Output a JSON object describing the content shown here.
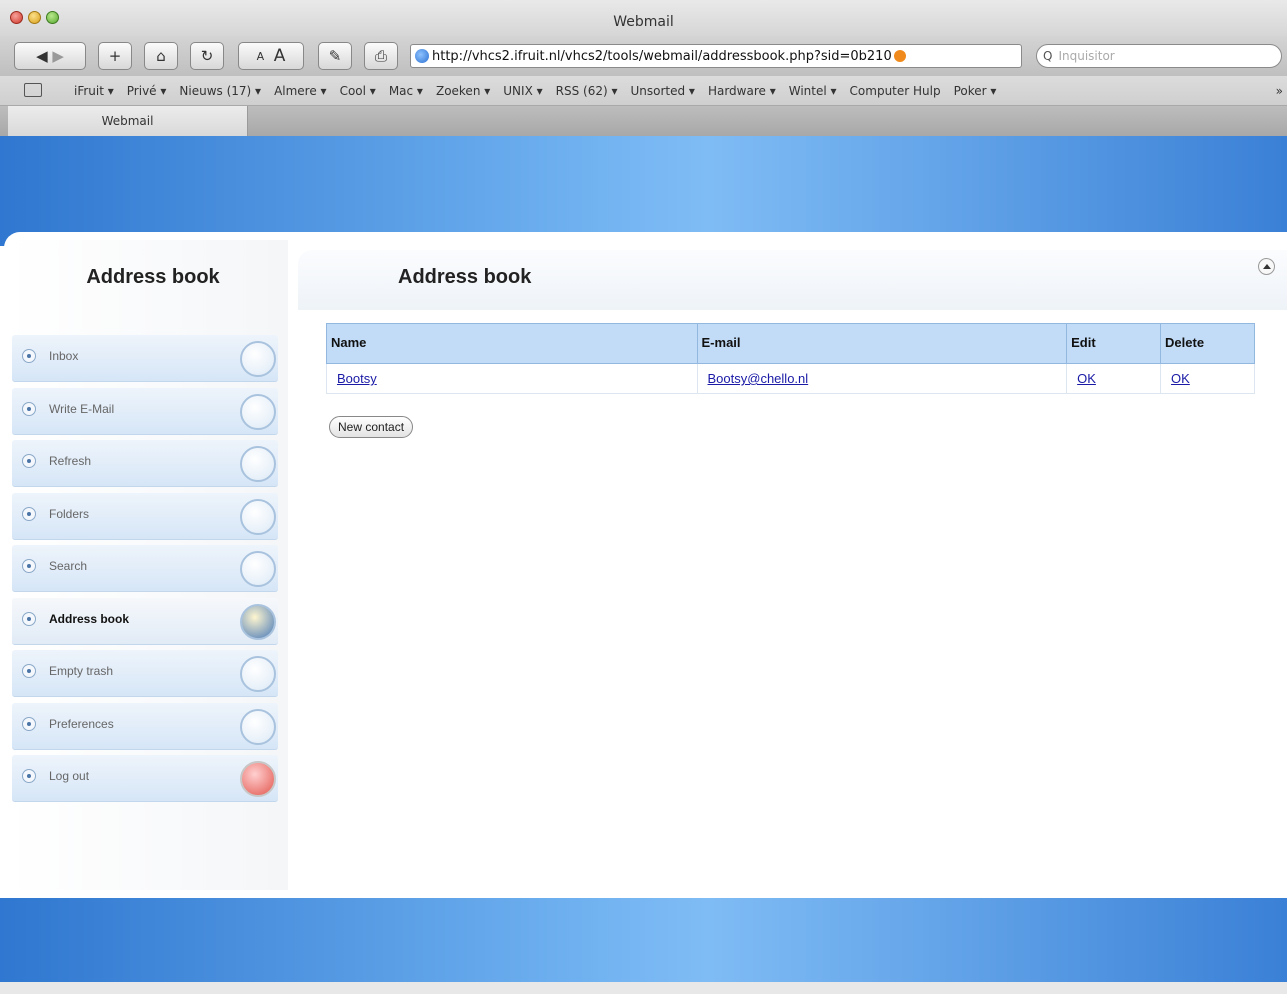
{
  "window": {
    "title": "Webmail"
  },
  "toolbar": {
    "back_icon": "back-forward-icon",
    "add_label": "+",
    "text_small": "A",
    "text_large": "A",
    "url": "http://vhcs2.ifruit.nl/vhcs2/tools/webmail/addressbook.php?sid=0b210",
    "search_placeholder": "Inquisitor",
    "search_glyph": "Q"
  },
  "bookmarks": {
    "items": [
      "iFruit ▾",
      "Privé ▾",
      "Nieuws (17) ▾",
      "Almere ▾",
      "Cool ▾",
      "Mac ▾",
      "Zoeken ▾",
      "UNIX ▾",
      "RSS (62) ▾",
      "Unsorted ▾",
      "Hardware ▾",
      "Wintel ▾",
      "Computer Hulp",
      "Poker ▾"
    ],
    "more": "»"
  },
  "tabs": [
    {
      "label": "Webmail"
    }
  ],
  "sidebar": {
    "title": "Address book",
    "items": [
      {
        "label": "Inbox",
        "icon": "inbox-icon"
      },
      {
        "label": "Write E-Mail",
        "icon": "write-icon"
      },
      {
        "label": "Refresh",
        "icon": "refresh-icon"
      },
      {
        "label": "Folders",
        "icon": "folders-icon"
      },
      {
        "label": "Search",
        "icon": "search-icon"
      },
      {
        "label": "Address book",
        "icon": "addressbook-icon",
        "active": true
      },
      {
        "label": "Empty trash",
        "icon": "trash-icon"
      },
      {
        "label": "Preferences",
        "icon": "preferences-icon"
      },
      {
        "label": "Log out",
        "icon": "logout-icon"
      }
    ]
  },
  "main": {
    "title": "Address book",
    "table": {
      "headers": [
        "Name",
        "E-mail",
        "Edit",
        "Delete"
      ],
      "rows": [
        {
          "name": "Bootsy",
          "email": "Bootsy@chello.nl",
          "edit": "OK",
          "delete": "OK"
        }
      ]
    },
    "new_contact_label": "New contact"
  }
}
